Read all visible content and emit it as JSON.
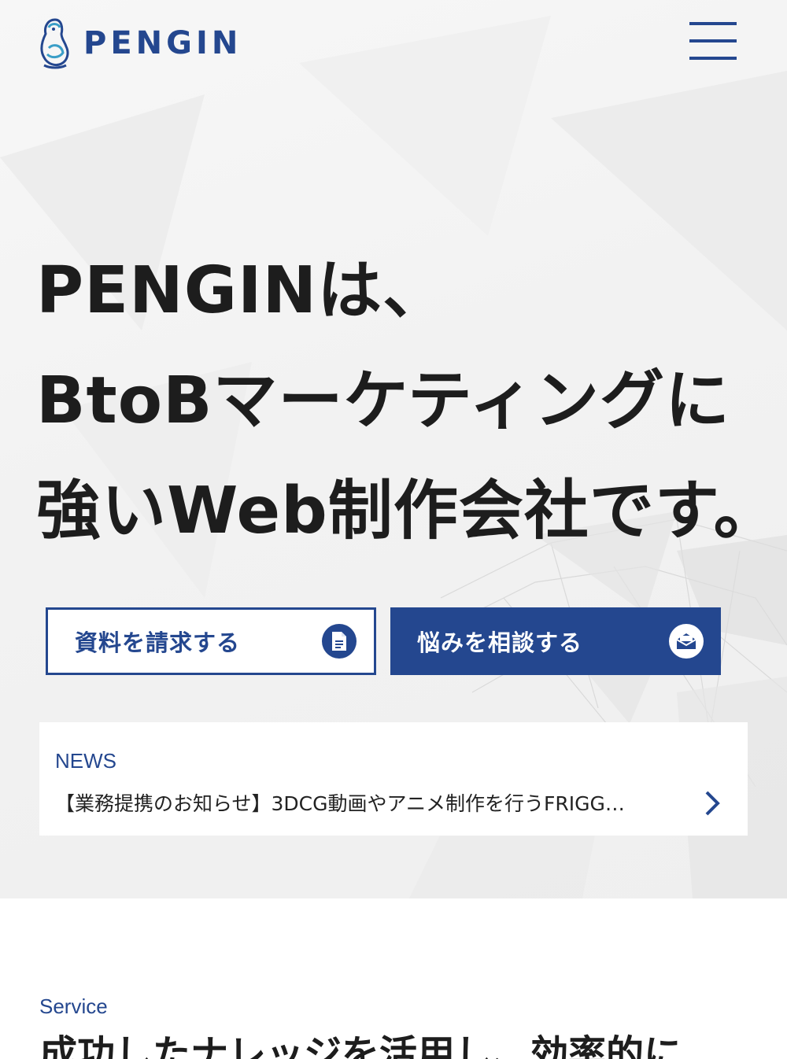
{
  "header": {
    "logo_text": "PENGIN",
    "brand_color": "#24478f",
    "menu_icon": "hamburger-menu-icon"
  },
  "hero": {
    "headline": [
      "PENGINは、",
      "BtoBマーケティングに",
      "強いWeb制作会社です。"
    ],
    "cta_document": {
      "label": "資料を請求する",
      "icon": "document-icon"
    },
    "cta_consult": {
      "label": "悩みを相談する",
      "icon": "mail-icon"
    }
  },
  "news": {
    "label": "NEWS",
    "item_text": "【業務提携のお知らせ】3DCG動画やアニメ制作を行うFRIGG…",
    "arrow_icon": "chevron-right-icon"
  },
  "service": {
    "label": "Service",
    "heading": "成功したナレッジを活用し、効率的に"
  }
}
